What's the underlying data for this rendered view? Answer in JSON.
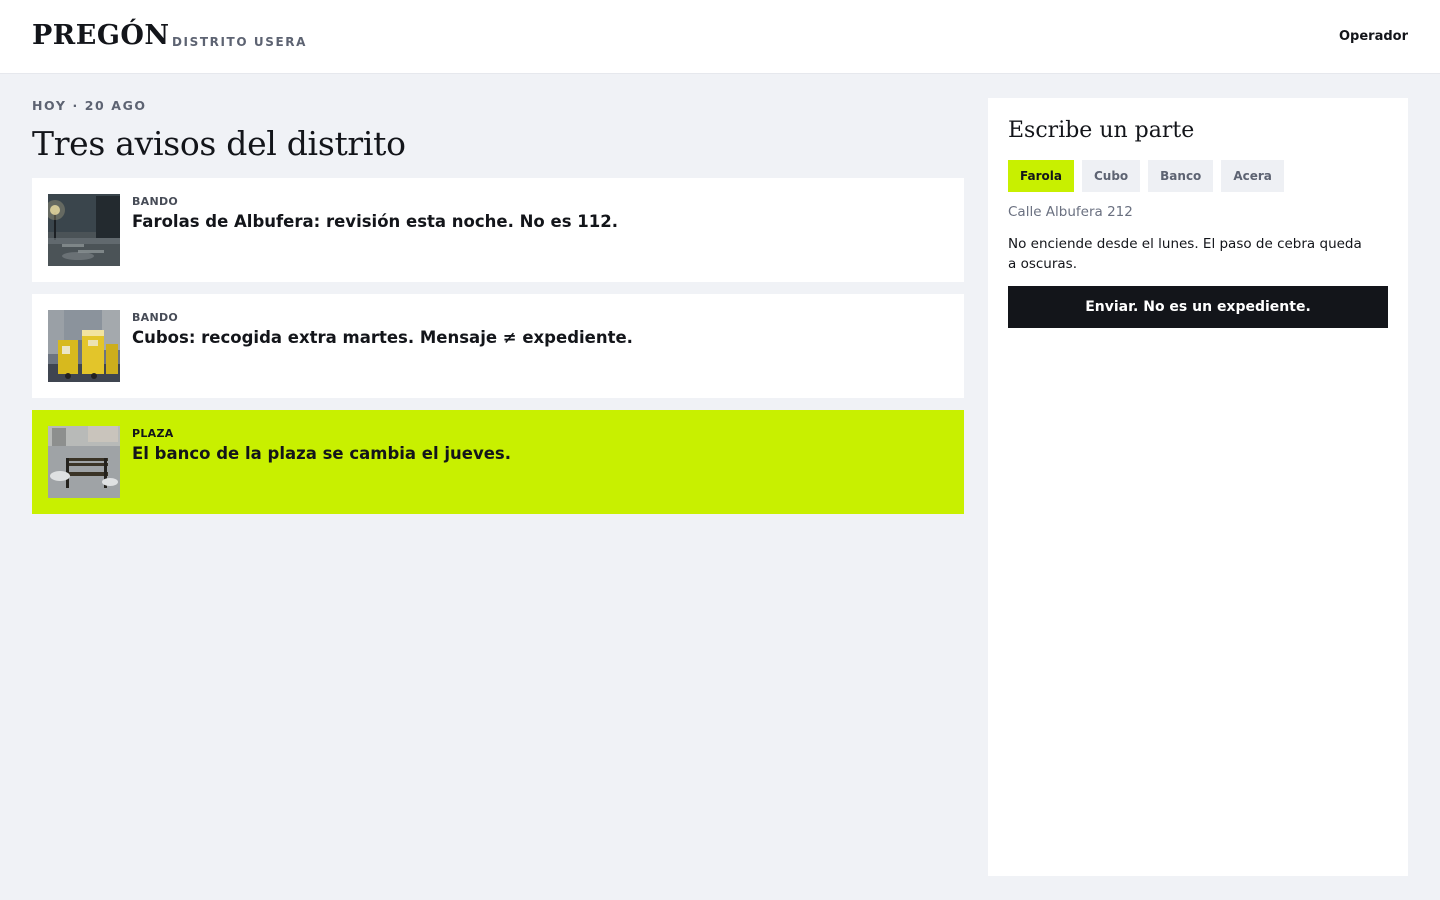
{
  "header": {
    "brand": "PREGÓN",
    "district": "DISTRITO USERA",
    "operator_link": "Operador"
  },
  "feed": {
    "date_label": "HOY · 20 AGO",
    "title": "Tres avisos del distrito",
    "notices": [
      {
        "tag": "BANDO",
        "title": "Farolas de Albufera: revisión esta noche. No es 112.",
        "image": "streetlight-night-photo"
      },
      {
        "tag": "BANDO",
        "title": "Cubos: recogida extra martes. Mensaje ≠ expediente.",
        "image": "trash-bins-photo"
      },
      {
        "tag": "PLAZA",
        "title": "El banco de la plaza se cambia el jueves.",
        "image": "park-bench-photo",
        "highlighted": true
      }
    ]
  },
  "report_form": {
    "title": "Escribe un parte",
    "categories": [
      {
        "label": "Farola",
        "active": true
      },
      {
        "label": "Cubo",
        "active": false
      },
      {
        "label": "Banco",
        "active": false
      },
      {
        "label": "Acera",
        "active": false
      }
    ],
    "address": "Calle Albufera 212",
    "description": "No enciende desde el lunes. El paso de cebra queda a oscuras.",
    "submit_label": "Enviar. No es un expediente."
  },
  "colors": {
    "accent": "#c8f000",
    "dark": "#13151a",
    "background": "#f0f2f6",
    "muted": "#5d6372"
  }
}
